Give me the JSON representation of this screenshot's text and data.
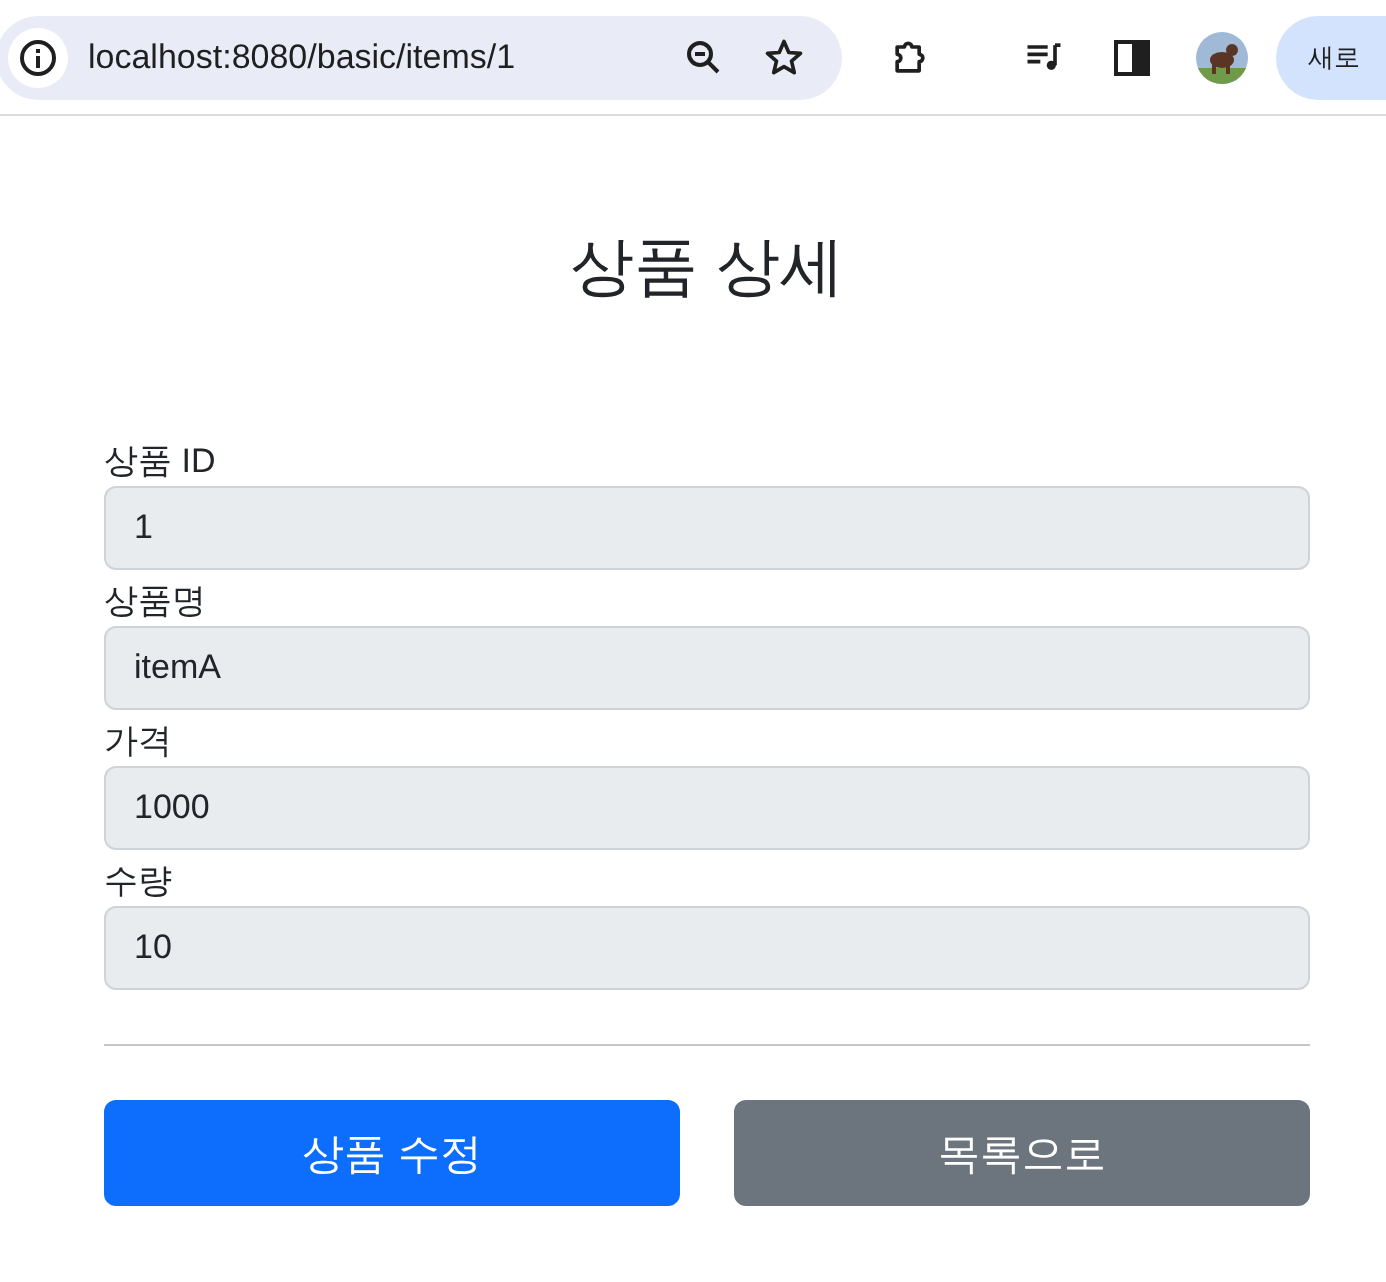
{
  "browser": {
    "url": "localhost:8080/basic/items/1",
    "profile_button": "새로"
  },
  "title": "상품 상세",
  "fields": [
    {
      "label": "상품 ID",
      "value": "1"
    },
    {
      "label": "상품명",
      "value": "itemA"
    },
    {
      "label": "가격",
      "value": "1000"
    },
    {
      "label": "수량",
      "value": "10"
    }
  ],
  "buttons": [
    {
      "label": "상품 수정",
      "kind": "primary"
    },
    {
      "label": "목록으로",
      "kind": "secondary"
    }
  ]
}
